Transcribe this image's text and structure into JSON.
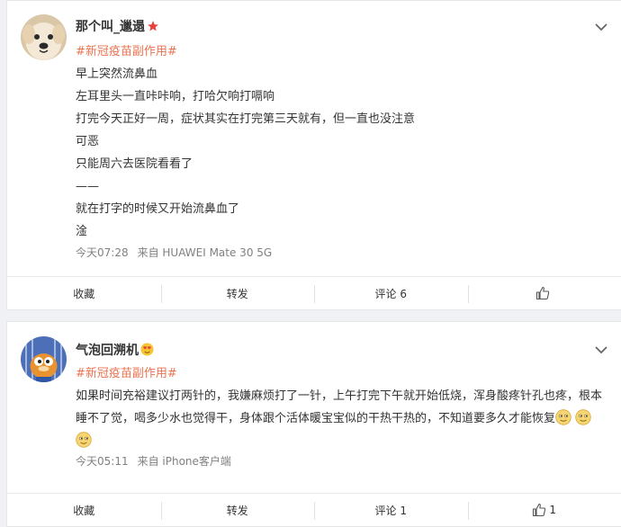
{
  "posts": [
    {
      "username": "那个叫_邋遢",
      "badge_icon": "star-icon",
      "hashtag": "#新冠疫苗副作用#",
      "lines": [
        "早上突然流鼻血",
        "左耳里头一直咔咔响，打哈欠响打嗝响",
        "打完今天正好一周，症状其实在打完第三天就有，但一直也没注意",
        "可恶",
        "只能周六去医院看看了",
        "——",
        "就在打字的时候又开始流鼻血了",
        "淦"
      ],
      "time": "今天07:28",
      "source": "来自 HUAWEI Mate 30 5G",
      "actions": {
        "favorite": "收藏",
        "repost": "转发",
        "comment": "评论 6",
        "like": ""
      }
    },
    {
      "username": "气泡回溯机",
      "badge_icon": "heart-eyes-icon",
      "hashtag": "#新冠疫苗副作用#",
      "text": "如果时间充裕建议打两针的，我嫌麻烦打了一针，上午打完下午就开始低烧，浑身酸疼针孔也疼，根本睡不了觉，喝多少水也觉得干，身体跟个活体暖宝宝似的干热干热的，不知道要多久才能恢复",
      "emojis": [
        "doge-emoji",
        "doge-emoji",
        "doge-emoji"
      ],
      "time": "今天05:11",
      "source": "来自 iPhone客户端",
      "actions": {
        "favorite": "收藏",
        "repost": "转发",
        "comment": "评论 1",
        "like": "1"
      }
    }
  ],
  "colors": {
    "hashtag": "#eb7350",
    "meta": "#808080",
    "background": "#eff1f4"
  }
}
